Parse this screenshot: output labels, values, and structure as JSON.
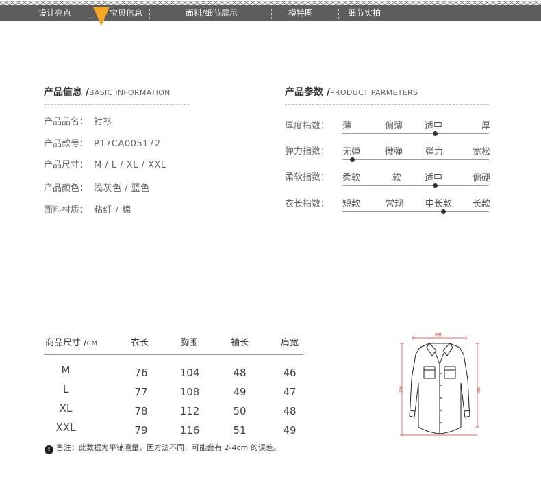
{
  "nav": {
    "tabs": [
      "设计亮点",
      "宝贝信息",
      "面料/细节展示",
      "模特图",
      "细节实拍"
    ],
    "active_index": 1,
    "bg_color": "#5d5d5d",
    "active_color": "#f5a623"
  },
  "info": {
    "title_cn": "产品信息 /",
    "title_en": "BASIC INFORMATION",
    "rows": [
      {
        "label": "产品品名：",
        "value": "衬衫"
      },
      {
        "label": "产品款号：",
        "value": "P17CA005172"
      },
      {
        "label": "产品尺寸：",
        "value": "M / L / XL / XXL"
      },
      {
        "label": "产品颜色：",
        "value": "浅灰色 / 蓝色"
      },
      {
        "label": "面料材质：",
        "value": "粘纤 / 棉"
      }
    ]
  },
  "params": {
    "title_cn": "产品参数 /",
    "title_en": "PRODUCT PARMETERS",
    "rows": [
      {
        "label": "厚度指数：",
        "options": [
          "薄",
          "偏薄",
          "适中",
          "厚"
        ],
        "selected": 2
      },
      {
        "label": "弹力指数：",
        "options": [
          "无弹",
          "微弹",
          "弹力",
          "宽松"
        ],
        "selected": 0
      },
      {
        "label": "柔软指数：",
        "options": [
          "柔软",
          "软",
          "适中",
          "偏硬"
        ],
        "selected": 2
      },
      {
        "label": "衣长指数：",
        "options": [
          "短款",
          "常规",
          "中长款",
          "长款"
        ],
        "selected": 2
      }
    ]
  },
  "size_table": {
    "header_label": "商品尺寸 /",
    "header_unit": "CM",
    "columns": [
      "衣长",
      "胸围",
      "袖长",
      "肩宽"
    ],
    "rows": [
      {
        "size": "M",
        "values": [
          "76",
          "104",
          "48",
          "46"
        ]
      },
      {
        "size": "L",
        "values": [
          "77",
          "108",
          "49",
          "47"
        ]
      },
      {
        "size": "XL",
        "values": [
          "78",
          "112",
          "50",
          "48"
        ]
      },
      {
        "size": "XXL",
        "values": [
          "79",
          "116",
          "51",
          "49"
        ]
      }
    ]
  },
  "note": {
    "icon": "exclamation-icon",
    "text": "备注：此数据为平铺测量，因方法不同，可能会有 2-4cm 的误差。"
  },
  "diagram": {
    "labels": {
      "shoulder": "肩宽",
      "chest": "胸围",
      "length": "衣长",
      "sleeve": "袖长"
    },
    "measure_color": "#d33333"
  }
}
